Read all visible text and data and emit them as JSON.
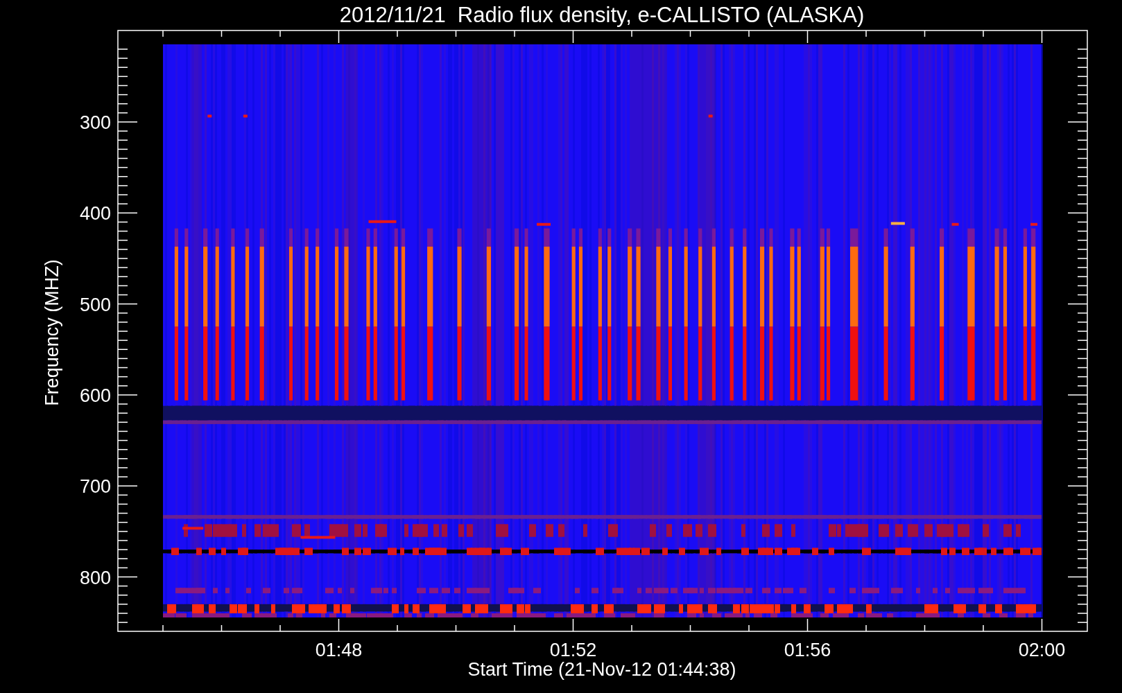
{
  "plot": {
    "title": "2012/11/21  Radio flux density, e-CALLISTO (ALASKA)",
    "ylabel": "Frequency (MHZ)",
    "xlabel": "Start Time (21-Nov-12 01:44:38)",
    "yticks": [
      "300",
      "400",
      "500",
      "600",
      "700",
      "800"
    ],
    "xticks": [
      "01:48",
      "01:52",
      "01:56",
      "02:00"
    ]
  }
}
